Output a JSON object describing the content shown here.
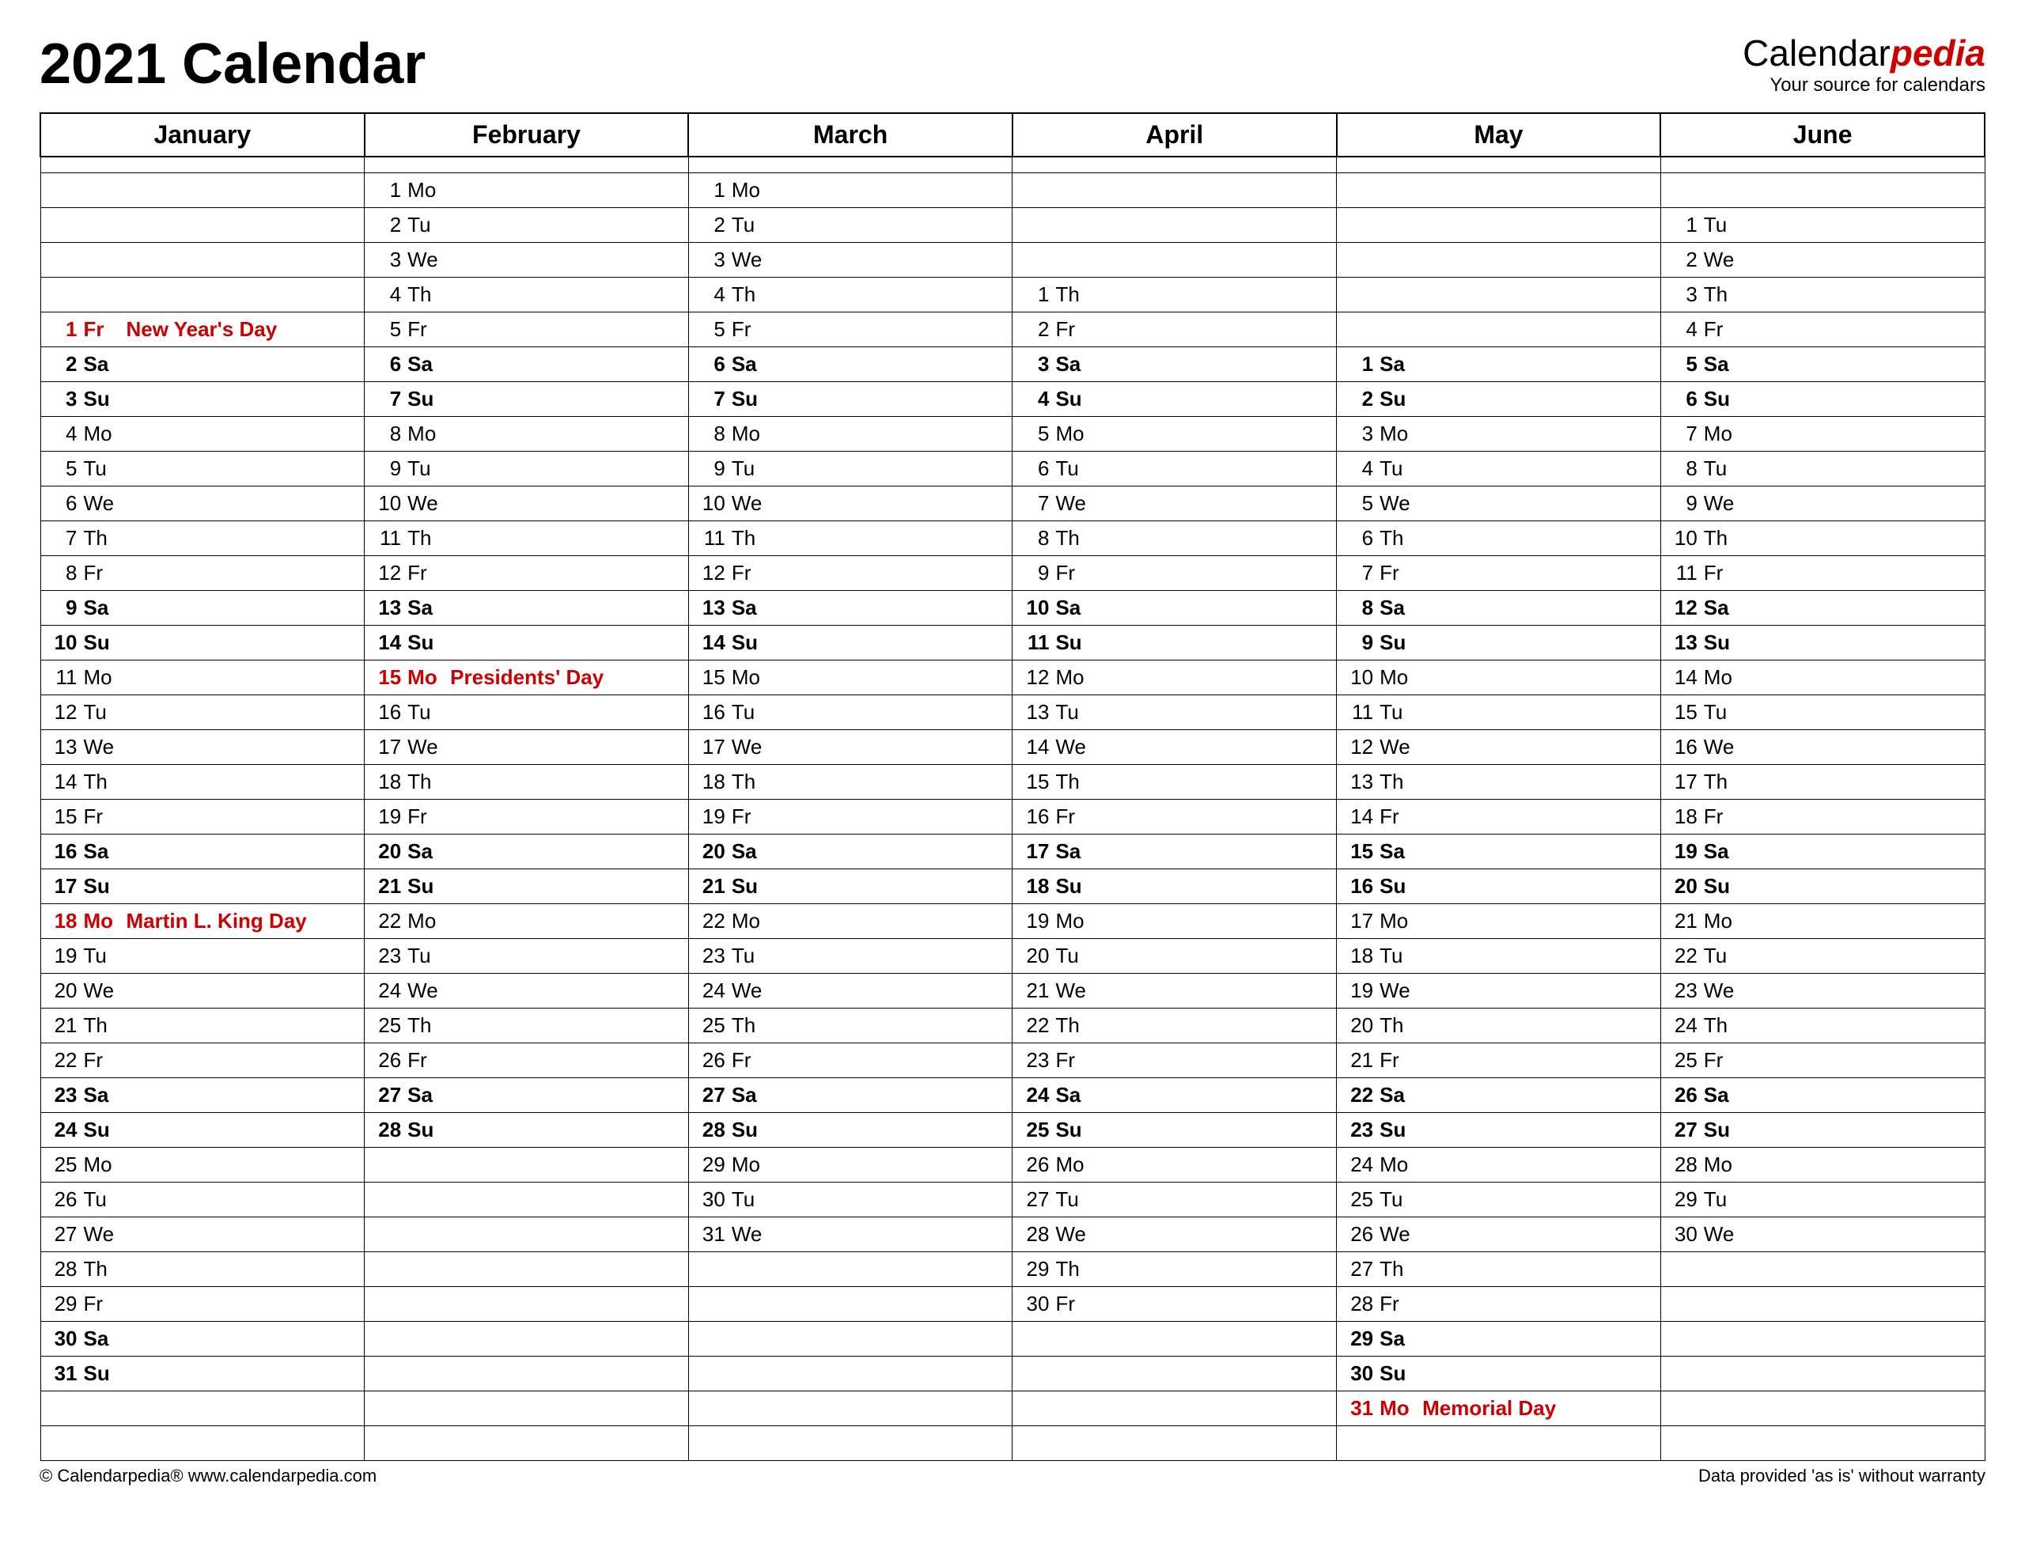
{
  "title": "2021 Calendar",
  "brand": {
    "prefix": "Calendar",
    "suffix": "pedia",
    "tagline": "Your source for calendars"
  },
  "footer": {
    "left": "© Calendarpedia®   www.calendarpedia.com",
    "right": "Data provided 'as is' without warranty"
  },
  "months": [
    "January",
    "February",
    "March",
    "April",
    "May",
    "June"
  ],
  "dow": [
    "Mo",
    "Tu",
    "We",
    "Th",
    "Fr",
    "Sa",
    "Su"
  ],
  "start_dow": [
    4,
    0,
    0,
    3,
    5,
    1
  ],
  "length": [
    31,
    28,
    31,
    30,
    31,
    30
  ],
  "holidays": {
    "0": {
      "1": "New Year's Day",
      "18": "Martin L. King Day"
    },
    "1": {
      "15": "Presidents' Day"
    },
    "4": {
      "31": "Memorial Day"
    }
  },
  "max_rows": 37
}
